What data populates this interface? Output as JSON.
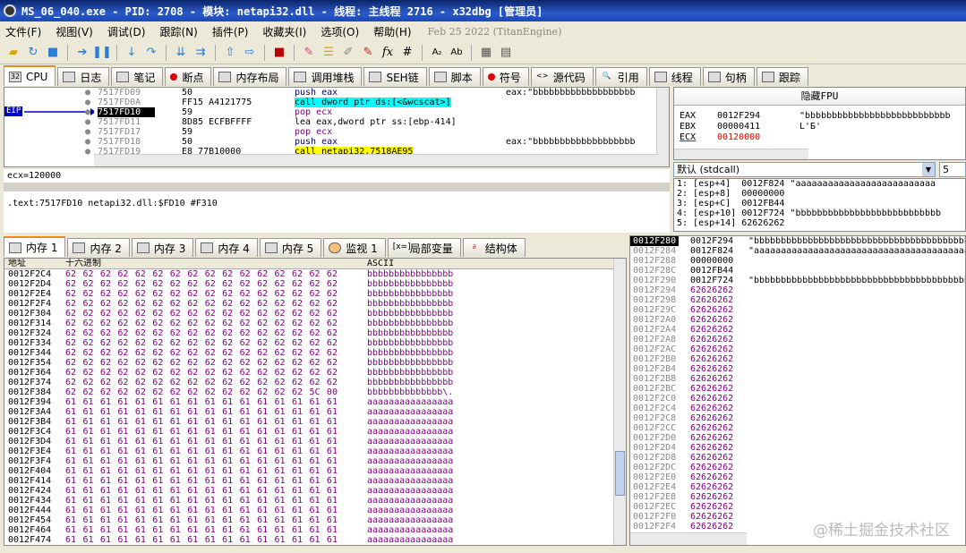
{
  "window": {
    "title": "MS_06_040.exe - PID: 2708 - 模块: netapi32.dll - 线程: 主线程 2716 - x32dbg [管理员]"
  },
  "menu": [
    "文件(F)",
    "视图(V)",
    "调试(D)",
    "跟踪(N)",
    "插件(P)",
    "收藏夹(I)",
    "选项(O)",
    "帮助(H)"
  ],
  "menu_date": "Feb 25 2022 (TitanEngine)",
  "tabs": [
    "CPU",
    "日志",
    "笔记",
    "断点",
    "内存布局",
    "调用堆栈",
    "SEH链",
    "脚本",
    "符号",
    "源代码",
    "引用",
    "线程",
    "句柄",
    "跟踪"
  ],
  "disasm": [
    {
      "addr": "7517FD09",
      "bytes": "50",
      "instr": "push eax",
      "comment": "eax:\"bbbbbbbbbbbbbbbbbbb"
    },
    {
      "addr": "7517FD0A",
      "bytes": "FF15 A4121775",
      "instr": "call dword ptr ds:[<&wcscat>]",
      "comment": ""
    },
    {
      "addr": "7517FD10",
      "bytes": "59",
      "instr": "pop ecx",
      "comment": ""
    },
    {
      "addr": "7517FD11",
      "bytes": "8D85 ECFBFFFF",
      "instr": "lea eax,dword ptr ss:[ebp-414]",
      "comment": ""
    },
    {
      "addr": "7517FD17",
      "bytes": "59",
      "instr": "pop ecx",
      "comment": ""
    },
    {
      "addr": "7517FD18",
      "bytes": "50",
      "instr": "push eax",
      "comment": "eax:\"bbbbbbbbbbbbbbbbbbb"
    },
    {
      "addr": "7517FD19",
      "bytes": "E8 77B10000",
      "instr": "call netapi32.7518AE95",
      "comment": ""
    }
  ],
  "eip_label": "EIP",
  "info_line1": "ecx=120000",
  "info_line2": ".text:7517FD10 netapi32.dll:$FD10 #F310",
  "regs": {
    "header": "隐藏FPU",
    "rows": [
      {
        "name": "EAX",
        "value": "0012F294",
        "comment": "\"bbbbbbbbbbbbbbbbbbbbbbbbbbb"
      },
      {
        "name": "EBX",
        "value": "00000411",
        "comment": "L'Б'"
      },
      {
        "name": "ECX",
        "value": "00120000",
        "comment": ""
      }
    ]
  },
  "callconv": {
    "selected": "默认 (stdcall)",
    "count": "5"
  },
  "args": [
    "1: [esp+4]  0012F824 \"aaaaaaaaaaaaaaaaaaaaaaaaaa",
    "2: [esp+8]  00000000",
    "3: [esp+C]  0012FB44",
    "4: [esp+10] 0012F724 \"bbbbbbbbbbbbbbbbbbbbbbbbbbb",
    "5: [esp+14] 62626262"
  ],
  "bottom_tabs": [
    "内存 1",
    "内存 2",
    "内存 3",
    "内存 4",
    "内存 5",
    "监视 1",
    "局部变量",
    "结构体"
  ],
  "dump": {
    "headers": {
      "addr": "地址",
      "hex": "十六进制",
      "ascii": "ASCII"
    },
    "rows": [
      {
        "addr": "0012F2C4",
        "hex": "62 62 62 62 62 62 62 62 62 62 62 62 62 62 62 62",
        "ascii": "bbbbbbbbbbbbbbbb"
      },
      {
        "addr": "0012F2D4",
        "hex": "62 62 62 62 62 62 62 62 62 62 62 62 62 62 62 62",
        "ascii": "bbbbbbbbbbbbbbbb"
      },
      {
        "addr": "0012F2E4",
        "hex": "62 62 62 62 62 62 62 62 62 62 62 62 62 62 62 62",
        "ascii": "bbbbbbbbbbbbbbbb"
      },
      {
        "addr": "0012F2F4",
        "hex": "62 62 62 62 62 62 62 62 62 62 62 62 62 62 62 62",
        "ascii": "bbbbbbbbbbbbbbbb"
      },
      {
        "addr": "0012F304",
        "hex": "62 62 62 62 62 62 62 62 62 62 62 62 62 62 62 62",
        "ascii": "bbbbbbbbbbbbbbbb"
      },
      {
        "addr": "0012F314",
        "hex": "62 62 62 62 62 62 62 62 62 62 62 62 62 62 62 62",
        "ascii": "bbbbbbbbbbbbbbbb"
      },
      {
        "addr": "0012F324",
        "hex": "62 62 62 62 62 62 62 62 62 62 62 62 62 62 62 62",
        "ascii": "bbbbbbbbbbbbbbbb"
      },
      {
        "addr": "0012F334",
        "hex": "62 62 62 62 62 62 62 62 62 62 62 62 62 62 62 62",
        "ascii": "bbbbbbbbbbbbbbbb"
      },
      {
        "addr": "0012F344",
        "hex": "62 62 62 62 62 62 62 62 62 62 62 62 62 62 62 62",
        "ascii": "bbbbbbbbbbbbbbbb"
      },
      {
        "addr": "0012F354",
        "hex": "62 62 62 62 62 62 62 62 62 62 62 62 62 62 62 62",
        "ascii": "bbbbbbbbbbbbbbbb"
      },
      {
        "addr": "0012F364",
        "hex": "62 62 62 62 62 62 62 62 62 62 62 62 62 62 62 62",
        "ascii": "bbbbbbbbbbbbbbbb"
      },
      {
        "addr": "0012F374",
        "hex": "62 62 62 62 62 62 62 62 62 62 62 62 62 62 62 62",
        "ascii": "bbbbbbbbbbbbbbbb"
      },
      {
        "addr": "0012F384",
        "hex": "62 62 62 62 62 62 62 62 62 62 62 62 62 62 5C 00",
        "ascii": "bbbbbbbbbbbbbb\\."
      },
      {
        "addr": "0012F394",
        "hex": "61 61 61 61 61 61 61 61 61 61 61 61 61 61 61 61",
        "ascii": "aaaaaaaaaaaaaaaa"
      },
      {
        "addr": "0012F3A4",
        "hex": "61 61 61 61 61 61 61 61 61 61 61 61 61 61 61 61",
        "ascii": "aaaaaaaaaaaaaaaa"
      },
      {
        "addr": "0012F3B4",
        "hex": "61 61 61 61 61 61 61 61 61 61 61 61 61 61 61 61",
        "ascii": "aaaaaaaaaaaaaaaa"
      },
      {
        "addr": "0012F3C4",
        "hex": "61 61 61 61 61 61 61 61 61 61 61 61 61 61 61 61",
        "ascii": "aaaaaaaaaaaaaaaa"
      },
      {
        "addr": "0012F3D4",
        "hex": "61 61 61 61 61 61 61 61 61 61 61 61 61 61 61 61",
        "ascii": "aaaaaaaaaaaaaaaa"
      },
      {
        "addr": "0012F3E4",
        "hex": "61 61 61 61 61 61 61 61 61 61 61 61 61 61 61 61",
        "ascii": "aaaaaaaaaaaaaaaa"
      },
      {
        "addr": "0012F3F4",
        "hex": "61 61 61 61 61 61 61 61 61 61 61 61 61 61 61 61",
        "ascii": "aaaaaaaaaaaaaaaa"
      },
      {
        "addr": "0012F404",
        "hex": "61 61 61 61 61 61 61 61 61 61 61 61 61 61 61 61",
        "ascii": "aaaaaaaaaaaaaaaa"
      },
      {
        "addr": "0012F414",
        "hex": "61 61 61 61 61 61 61 61 61 61 61 61 61 61 61 61",
        "ascii": "aaaaaaaaaaaaaaaa"
      },
      {
        "addr": "0012F424",
        "hex": "61 61 61 61 61 61 61 61 61 61 61 61 61 61 61 61",
        "ascii": "aaaaaaaaaaaaaaaa"
      },
      {
        "addr": "0012F434",
        "hex": "61 61 61 61 61 61 61 61 61 61 61 61 61 61 61 61",
        "ascii": "aaaaaaaaaaaaaaaa"
      },
      {
        "addr": "0012F444",
        "hex": "61 61 61 61 61 61 61 61 61 61 61 61 61 61 61 61",
        "ascii": "aaaaaaaaaaaaaaaa"
      },
      {
        "addr": "0012F454",
        "hex": "61 61 61 61 61 61 61 61 61 61 61 61 61 61 61 61",
        "ascii": "aaaaaaaaaaaaaaaa"
      },
      {
        "addr": "0012F464",
        "hex": "61 61 61 61 61 61 61 61 61 61 61 61 61 61 61 61",
        "ascii": "aaaaaaaaaaaaaaaa"
      },
      {
        "addr": "0012F474",
        "hex": "61 61 61 61 61 61 61 61 61 61 61 61 61 61 61 61",
        "ascii": "aaaaaaaaaaaaaaaa"
      }
    ]
  },
  "stack": [
    {
      "addr": "0012F280",
      "val": "0012F294",
      "cmt": "\"bbbbbbbbbbbbbbbbbbbbbbbbbbbbbbbbbbbbbbbbbbbbb"
    },
    {
      "addr": "0012F284",
      "val": "0012F824",
      "cmt": "\"aaaaaaaaaaaaaaaaaaaaaaaaaaaaaaaaaaaaaaaaaaaaa"
    },
    {
      "addr": "0012F288",
      "val": "00000000",
      "cmt": ""
    },
    {
      "addr": "0012F28C",
      "val": "0012FB44",
      "cmt": ""
    },
    {
      "addr": "0012F290",
      "val": "0012F724",
      "cmt": "\"bbbbbbbbbbbbbbbbbbbbbbbbbbbbbbbbbbbbbbbbbbbbb"
    },
    {
      "addr": "0012F294",
      "val": "62626262",
      "cmt": ""
    },
    {
      "addr": "0012F298",
      "val": "62626262",
      "cmt": ""
    },
    {
      "addr": "0012F29C",
      "val": "62626262",
      "cmt": ""
    },
    {
      "addr": "0012F2A0",
      "val": "62626262",
      "cmt": ""
    },
    {
      "addr": "0012F2A4",
      "val": "62626262",
      "cmt": ""
    },
    {
      "addr": "0012F2A8",
      "val": "62626262",
      "cmt": ""
    },
    {
      "addr": "0012F2AC",
      "val": "62626262",
      "cmt": ""
    },
    {
      "addr": "0012F2B0",
      "val": "62626262",
      "cmt": ""
    },
    {
      "addr": "0012F2B4",
      "val": "62626262",
      "cmt": ""
    },
    {
      "addr": "0012F2B8",
      "val": "62626262",
      "cmt": ""
    },
    {
      "addr": "0012F2BC",
      "val": "62626262",
      "cmt": ""
    },
    {
      "addr": "0012F2C0",
      "val": "62626262",
      "cmt": ""
    },
    {
      "addr": "0012F2C4",
      "val": "62626262",
      "cmt": ""
    },
    {
      "addr": "0012F2C8",
      "val": "62626262",
      "cmt": ""
    },
    {
      "addr": "0012F2CC",
      "val": "62626262",
      "cmt": ""
    },
    {
      "addr": "0012F2D0",
      "val": "62626262",
      "cmt": ""
    },
    {
      "addr": "0012F2D4",
      "val": "62626262",
      "cmt": ""
    },
    {
      "addr": "0012F2D8",
      "val": "62626262",
      "cmt": ""
    },
    {
      "addr": "0012F2DC",
      "val": "62626262",
      "cmt": ""
    },
    {
      "addr": "0012F2E0",
      "val": "62626262",
      "cmt": ""
    },
    {
      "addr": "0012F2E4",
      "val": "62626262",
      "cmt": ""
    },
    {
      "addr": "0012F2E8",
      "val": "62626262",
      "cmt": ""
    },
    {
      "addr": "0012F2EC",
      "val": "62626262",
      "cmt": ""
    },
    {
      "addr": "0012F2F0",
      "val": "62626262",
      "cmt": ""
    },
    {
      "addr": "0012F2F4",
      "val": "62626262",
      "cmt": ""
    }
  ],
  "watermark": "@稀土掘金技术社区",
  "colors": {
    "accent": "#e88b1a",
    "hex_text": "#800080",
    "highlight_row": "#000000",
    "eip_arrow": "#0000c8"
  }
}
